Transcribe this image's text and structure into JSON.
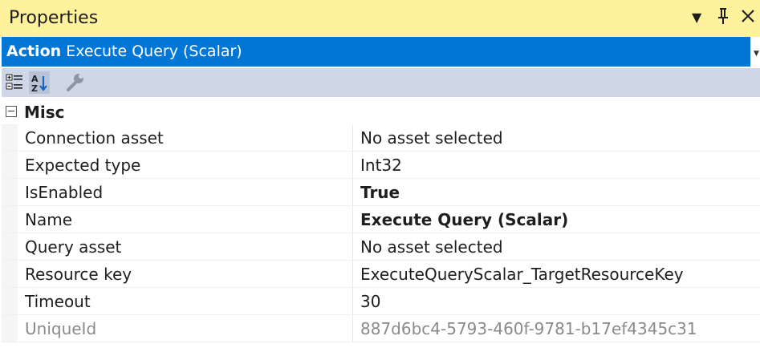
{
  "window": {
    "title": "Properties",
    "pin_glyph": "━",
    "colors": {
      "title_bg": "#fff29d",
      "selector_bg": "#0077d7",
      "toolbar_bg": "#cfd6e5"
    }
  },
  "object_selector": {
    "kind": "Action",
    "name": "Execute Query (Scalar)"
  },
  "toolbar": {
    "buttons": [
      {
        "icon": "categorized-icon"
      },
      {
        "icon": "alphabetical-sort-icon"
      },
      {
        "icon": "wrench-icon"
      }
    ]
  },
  "grid": {
    "category": "Misc",
    "rows": [
      {
        "name": "Connection asset",
        "value": "No asset selected",
        "bold": false,
        "disabled": false
      },
      {
        "name": "Expected type",
        "value": "Int32",
        "bold": false,
        "disabled": false
      },
      {
        "name": "IsEnabled",
        "value": "True",
        "bold": true,
        "disabled": false
      },
      {
        "name": "Name",
        "value": "Execute Query (Scalar)",
        "bold": true,
        "disabled": false
      },
      {
        "name": "Query asset",
        "value": "No asset selected",
        "bold": false,
        "disabled": false
      },
      {
        "name": "Resource key",
        "value": "ExecuteQueryScalar_TargetResourceKey",
        "bold": false,
        "disabled": false
      },
      {
        "name": "Timeout",
        "value": "30",
        "bold": false,
        "disabled": false
      },
      {
        "name": "UniqueId",
        "value": "887d6bc4-5793-460f-9781-b17ef4345c31",
        "bold": false,
        "disabled": true
      }
    ]
  }
}
